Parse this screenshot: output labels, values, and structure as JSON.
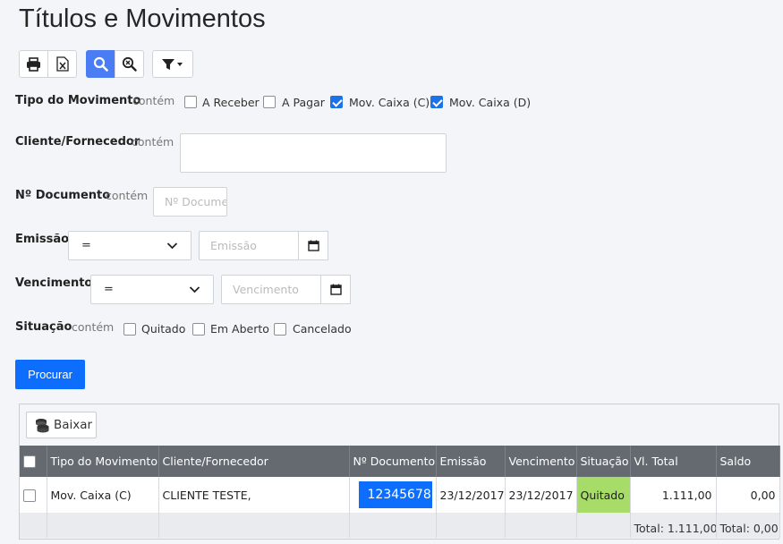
{
  "page": {
    "title": "Títulos e Movimentos"
  },
  "toolbar": {
    "print": "print-icon",
    "excel": "excel-icon",
    "search": "search-icon",
    "clear_search": "clear-search-icon",
    "filter": "filter-icon"
  },
  "filters": {
    "tipo": {
      "label": "Tipo do Movimento",
      "operator": "contém",
      "options": [
        {
          "label": "A Receber",
          "checked": false
        },
        {
          "label": "A Pagar",
          "checked": false
        },
        {
          "label": "Mov. Caixa (C)",
          "checked": true
        },
        {
          "label": "Mov. Caixa (D)",
          "checked": true
        }
      ]
    },
    "cliente": {
      "label": "Cliente/Fornecedor",
      "operator": "contém",
      "value": ""
    },
    "documento": {
      "label": "Nº Documento",
      "operator": "contém",
      "placeholder": "Nº Documento"
    },
    "emissao": {
      "label": "Emissão",
      "operator": "=",
      "placeholder": "Emissão"
    },
    "vencimento": {
      "label": "Vencimento",
      "operator": "=",
      "placeholder": "Vencimento"
    },
    "situacao": {
      "label": "Situação",
      "operator": "contém",
      "options": [
        {
          "label": "Quitado",
          "checked": false
        },
        {
          "label": "Em Aberto",
          "checked": false
        },
        {
          "label": "Cancelado",
          "checked": false
        }
      ]
    },
    "submit_label": "Procurar"
  },
  "grid": {
    "baixar_label": "Baixar",
    "columns": [
      "Tipo do Movimento",
      "Cliente/Fornecedor",
      "Nº Documento",
      "Emissão",
      "Vencimento",
      "Situação",
      "Vl. Total",
      "Saldo"
    ],
    "rows": [
      {
        "tipo": "Mov. Caixa (C)",
        "cliente": "CLIENTE TESTE,",
        "documento": "12345678",
        "emissao": "23/12/2017",
        "vencimento": "23/12/2017",
        "situacao": "Quitado",
        "total": "1.111,00",
        "saldo": "0,00"
      }
    ],
    "footer": {
      "total": "Total: 1.111,00",
      "saldo": "Total: 0,00"
    }
  },
  "colors": {
    "primary": "#0d6efd",
    "header": "#646a70",
    "quitado": "#a6dc67"
  }
}
